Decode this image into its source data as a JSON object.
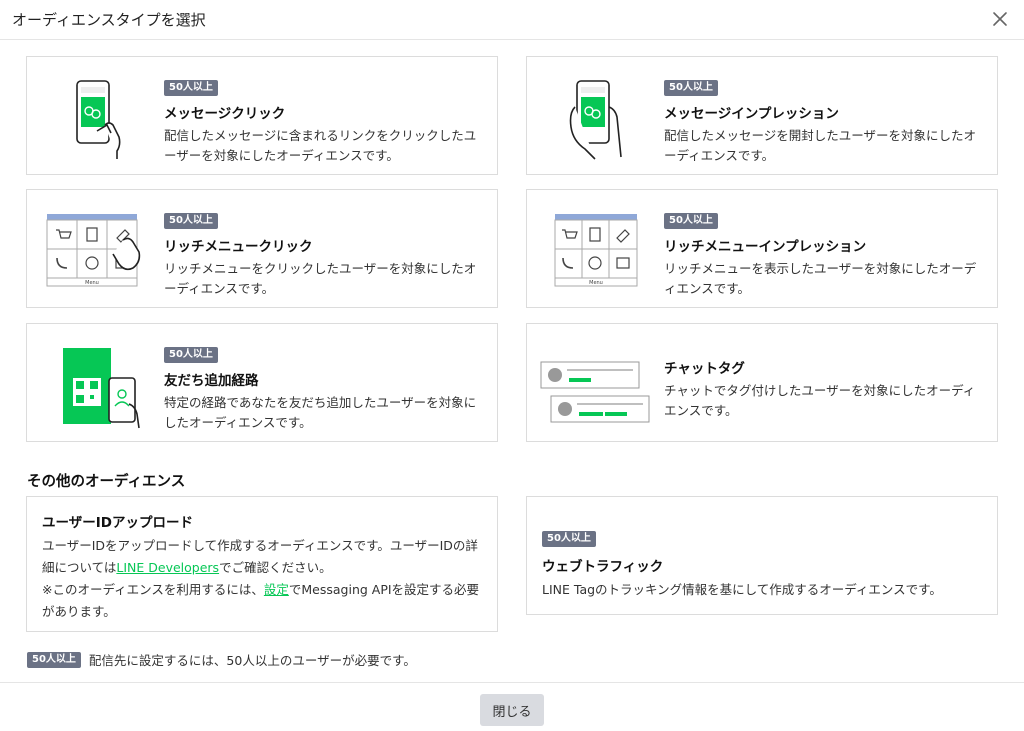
{
  "header": {
    "title": "オーディエンスタイプを選択"
  },
  "cards": [
    {
      "badge": "50人以上",
      "title": "メッセージクリック",
      "desc": "配信したメッセージに含まれるリンクをクリックしたユーザーを対象にしたオーディエンスです。"
    },
    {
      "badge": "50人以上",
      "title": "メッセージインプレッション",
      "desc": "配信したメッセージを開封したユーザーを対象にしたオーディエンスです。"
    },
    {
      "badge": "50人以上",
      "title": "リッチメニュークリック",
      "desc": "リッチメニューをクリックしたユーザーを対象にしたオーディエンスです。"
    },
    {
      "badge": "50人以上",
      "title": "リッチメニューインプレッション",
      "desc": "リッチメニューを表示したユーザーを対象にしたオーディエンスです。"
    },
    {
      "badge": "50人以上",
      "title": "友だち追加経路",
      "desc": "特定の経路であなたを友だち追加したユーザーを対象にしたオーディエンスです。"
    },
    {
      "title": "チャットタグ",
      "desc": "チャットでタグ付けしたユーザーを対象にしたオーディエンスです。"
    }
  ],
  "rich_menu_label": "Menu",
  "other_section": {
    "title": "その他のオーディエンス"
  },
  "upload_card": {
    "title": "ユーザーIDアップロード",
    "desc_pre": "ユーザーIDをアップロードして作成するオーディエンスです。ユーザーIDの詳細については",
    "link1": "LINE Developers",
    "desc_mid": "でご確認ください。",
    "note_pre": "※このオーディエンスを利用するには、",
    "link2": "設定",
    "note_post": "でMessaging APIを設定する必要があります。"
  },
  "web_card": {
    "badge": "50人以上",
    "title": "ウェブトラフィック",
    "desc": "LINE Tagのトラッキング情報を基にして作成するオーディエンスです。"
  },
  "footer_note": {
    "badge": "50人以上",
    "text": "配信先に設定するには、50人以上のユーザーが必要です。"
  },
  "footer": {
    "close_label": "閉じる"
  },
  "colors": {
    "accent": "#06c755",
    "badge": "#6b7285",
    "menu_blue": "#8fa8d8"
  }
}
